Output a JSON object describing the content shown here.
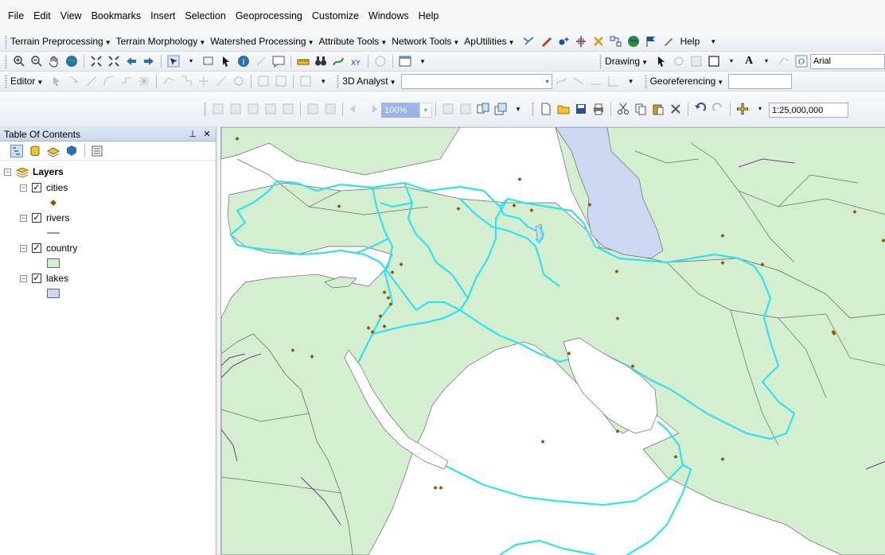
{
  "menu": [
    "File",
    "Edit",
    "View",
    "Bookmarks",
    "Insert",
    "Selection",
    "Geoprocessing",
    "Customize",
    "Windows",
    "Help"
  ],
  "toolbar1": {
    "items": [
      "Terrain Preprocessing",
      "Terrain Morphology",
      "Watershed Processing",
      "Attribute Tools",
      "Network Tools",
      "ApUtilities"
    ],
    "help": "Help"
  },
  "toolbar2": {
    "drawing": "Drawing",
    "font": "Arial"
  },
  "toolbar3": {
    "editor": "Editor",
    "analyst": "3D Analyst",
    "georef": "Georeferencing"
  },
  "toolbar4": {
    "zoom_percent": "100%",
    "scale": "1:25,000,000"
  },
  "toc": {
    "title": "Table Of Contents",
    "root": "Layers",
    "layers": [
      {
        "name": "cities",
        "symbol": "point",
        "color": "#8b5a00"
      },
      {
        "name": "rivers",
        "symbol": "line",
        "color": "#7a3a8a"
      },
      {
        "name": "country",
        "symbol": "polygon",
        "color": "#d4efd0"
      },
      {
        "name": "lakes",
        "symbol": "polygon",
        "color": "#cdd7f2"
      }
    ]
  },
  "map": {
    "colors": {
      "sea": "#ffffff",
      "land": "#d4efd0",
      "lake": "#cdd7f2",
      "border": "#6b6b6b",
      "river": "#7a3a8a",
      "city": "#8b5a00",
      "highlight": "#33e0f0"
    }
  }
}
